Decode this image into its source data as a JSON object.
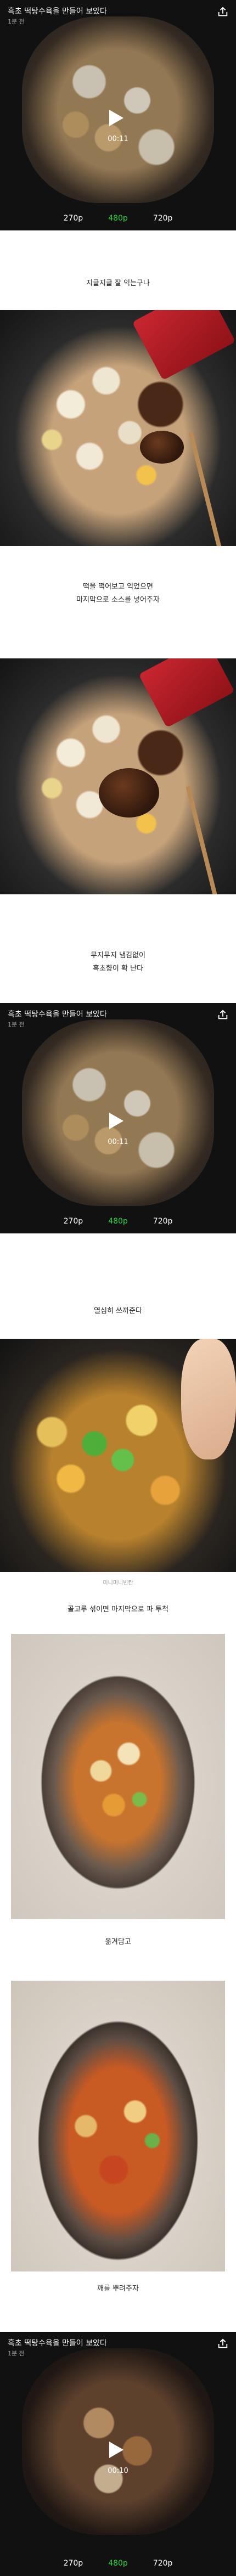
{
  "videos": [
    {
      "title": "흑초 떡탕수육을 만들어 보았다",
      "sub": "1분 전",
      "time": "00:11",
      "qualities": [
        "270p",
        "480p",
        "720p"
      ],
      "active_quality": "480p"
    },
    {
      "title": "흑초 떡탕수육을 만들어 보았다",
      "sub": "1분 전",
      "time": "00:11",
      "qualities": [
        "270p",
        "480p",
        "720p"
      ],
      "active_quality": "480p"
    },
    {
      "title": "흑초 떡탕수육을 만들어 보았다",
      "sub": "1분 전",
      "time": "00:10",
      "qualities": [
        "270p",
        "480p",
        "720p"
      ],
      "active_quality": "480p"
    }
  ],
  "captions": {
    "c1": "지글지글 잘 익는구나",
    "c2_line1": "떡을 떡어보고 익었으면",
    "c2_line2": "마지막으로 소스를 넣어주자",
    "c3_line1": "무지무지 냄김없이",
    "c3_line2": "흑초향이 확 난다",
    "c4": "열심히 쓰까준다",
    "c5_small": "미니미니빈칸",
    "c5": "골고루 섞이면 마지막으로 파 투척",
    "c6": "옮겨담고",
    "c7": "깨를 뿌려주자"
  },
  "colors": {
    "quality_active": "#2fd23e",
    "video_bg": "#111111"
  },
  "icons": {
    "share": "share-icon",
    "play": "play-icon"
  }
}
